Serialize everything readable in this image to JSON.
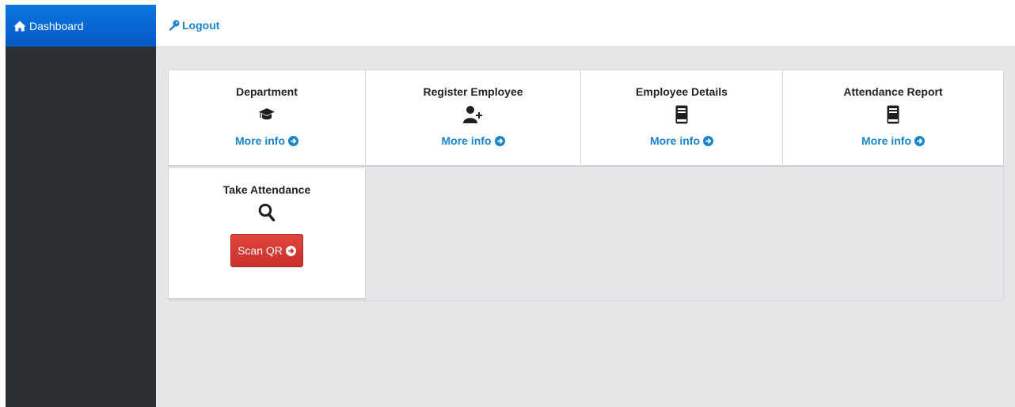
{
  "sidebar": {
    "brand_label": "Dashboard",
    "brand_icon": "home-icon"
  },
  "topbar": {
    "logout_label": "Logout",
    "logout_icon": "key-icon"
  },
  "cards": [
    {
      "title": "Department",
      "icon": "graduation-cap-icon",
      "link": "More info"
    },
    {
      "title": "Register Employee",
      "icon": "user-plus-icon",
      "link": "More info"
    },
    {
      "title": "Employee Details",
      "icon": "book-icon",
      "link": "More info"
    },
    {
      "title": "Attendance Report",
      "icon": "book-icon",
      "link": "More info"
    },
    {
      "title": "Take Attendance",
      "icon": "search-icon",
      "button": "Scan QR"
    }
  ],
  "colors": {
    "sidebar_bg": "#2c3035",
    "brand_bg": "#0a6fdc",
    "link": "#1a84c9",
    "content_bg": "#e5e6e8",
    "danger": "#d9443a"
  }
}
